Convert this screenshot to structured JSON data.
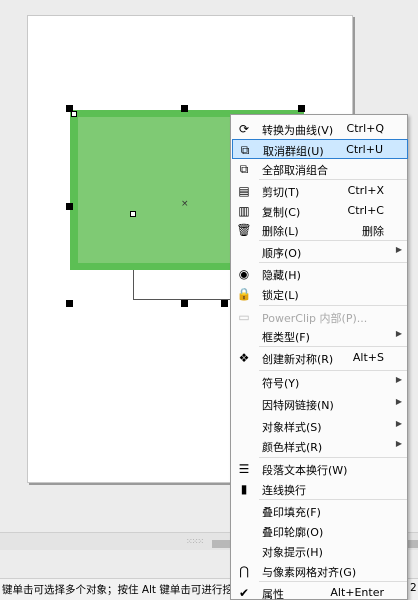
{
  "status": {
    "left_text": "键单击可选择多个对象；按住 Alt 键单击可进行挖掘",
    "right_text": "2"
  },
  "grip_label": "⁙⁙⁙",
  "menu": {
    "items": [
      {
        "key": "convert_to_curves",
        "label": "转换为曲线(V)",
        "shortcut": "Ctrl+Q",
        "icon": "convert-to-curves-icon",
        "glyph": "⟳"
      },
      {
        "key": "ungroup",
        "label": "取消群组(U)",
        "shortcut": "Ctrl+U",
        "icon": "ungroup-icon",
        "glyph": "⧉",
        "highlighted": true
      },
      {
        "key": "ungroup_all",
        "label": "全部取消组合",
        "shortcut": "",
        "icon": "ungroup-all-icon",
        "glyph": "⧉"
      },
      {
        "key": "cut",
        "label": "剪切(T)",
        "shortcut": "Ctrl+X",
        "icon": "cut-icon",
        "glyph": "▤"
      },
      {
        "key": "copy",
        "label": "复制(C)",
        "shortcut": "Ctrl+C",
        "icon": "copy-icon",
        "glyph": "▥"
      },
      {
        "key": "delete",
        "label": "删除(L)",
        "shortcut": "删除",
        "icon": "trash-icon",
        "glyph": "🗑"
      },
      {
        "key": "order",
        "label": "顺序(O)",
        "shortcut": "",
        "icon": "",
        "glyph": "",
        "submenu": true
      },
      {
        "key": "hide",
        "label": "隐藏(H)",
        "shortcut": "",
        "icon": "eye-icon",
        "glyph": "◉"
      },
      {
        "key": "lock",
        "label": "锁定(L)",
        "shortcut": "",
        "icon": "lock-icon",
        "glyph": "🔒"
      },
      {
        "key": "powerclip",
        "label": "PowerClip 内部(P)...",
        "shortcut": "",
        "icon": "powerclip-icon",
        "glyph": "▭",
        "disabled": true
      },
      {
        "key": "frame_type",
        "label": "框类型(F)",
        "shortcut": "",
        "icon": "",
        "glyph": "",
        "submenu": true
      },
      {
        "key": "create_symbol",
        "label": "创建新对称(R)",
        "shortcut": "Alt+S",
        "icon": "symbol-icon",
        "glyph": "❖"
      },
      {
        "key": "symbol",
        "label": "符号(Y)",
        "shortcut": "",
        "icon": "",
        "glyph": "",
        "submenu": true
      },
      {
        "key": "internet_link",
        "label": "因特网链接(N)",
        "shortcut": "",
        "icon": "",
        "glyph": "",
        "submenu": true
      },
      {
        "key": "object_styles",
        "label": "对象样式(S)",
        "shortcut": "",
        "icon": "",
        "glyph": "",
        "submenu": true
      },
      {
        "key": "color_styles",
        "label": "颜色样式(R)",
        "shortcut": "",
        "icon": "",
        "glyph": "",
        "submenu": true
      },
      {
        "key": "paragraph_wrap",
        "label": "段落文本换行(W)",
        "shortcut": "",
        "icon": "text-wrap-icon",
        "glyph": "☰"
      },
      {
        "key": "connector_wrap",
        "label": "连线换行",
        "shortcut": "",
        "icon": "connector-icon",
        "glyph": "▮"
      },
      {
        "key": "overprint_fill",
        "label": "叠印填充(F)",
        "shortcut": "",
        "icon": "",
        "glyph": ""
      },
      {
        "key": "overprint_outline",
        "label": "叠印轮廓(O)",
        "shortcut": "",
        "icon": "",
        "glyph": ""
      },
      {
        "key": "object_hints",
        "label": "对象提示(H)",
        "shortcut": "",
        "icon": "",
        "glyph": ""
      },
      {
        "key": "pixel_align",
        "label": "与像素网格对齐(G)",
        "shortcut": "",
        "icon": "magnet-icon",
        "glyph": "⋂"
      },
      {
        "key": "properties",
        "label": "属性",
        "shortcut": "Alt+Enter",
        "icon": "check-icon",
        "glyph": "✔"
      }
    ]
  },
  "colors": {
    "fill_outer": "#5cbf54",
    "fill_inner": "#7fca74",
    "menu_highlight": "#cde8ff",
    "menu_highlight_border": "#2c7fd1"
  }
}
